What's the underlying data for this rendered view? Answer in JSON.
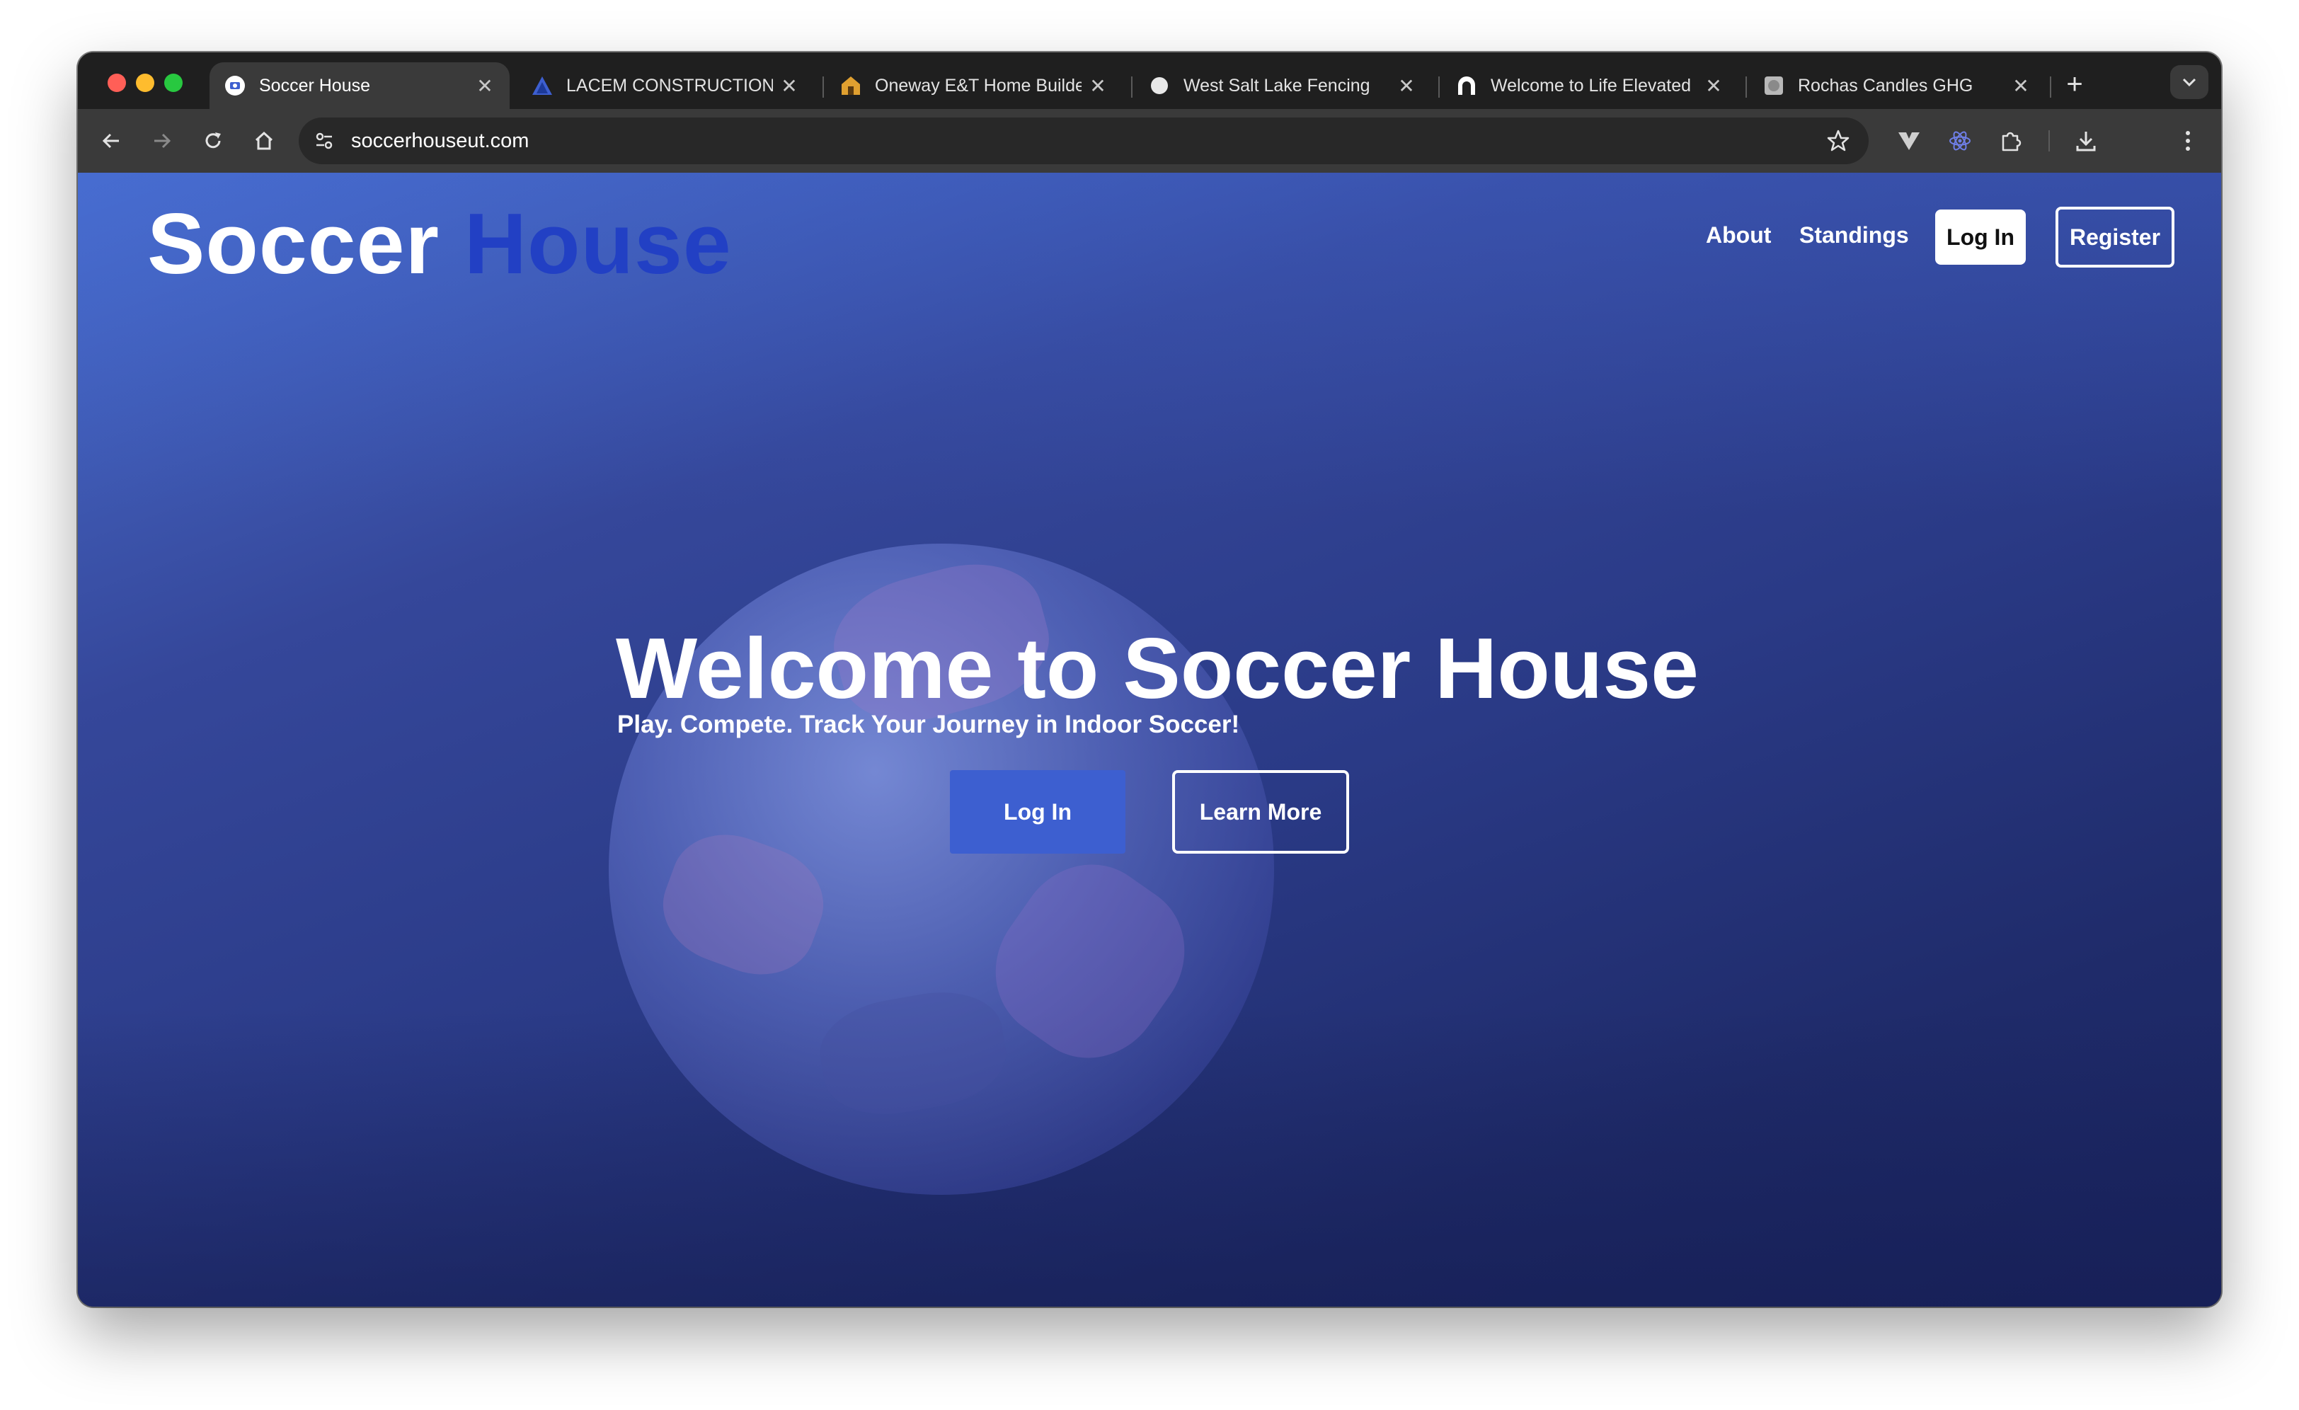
{
  "browser": {
    "tabs": [
      {
        "title": "Soccer House",
        "icon": "soccer-house-favicon",
        "active": true
      },
      {
        "title": "LACEM CONSTRUCTION",
        "icon": "triangle-favicon",
        "active": false
      },
      {
        "title": "Oneway E&T Home Builde",
        "icon": "house-favicon",
        "active": false
      },
      {
        "title": "West Salt Lake Fencing",
        "icon": "circle-favicon",
        "active": false
      },
      {
        "title": "Welcome to Life Elevated",
        "icon": "arch-favicon",
        "active": false
      },
      {
        "title": "Rochas Candles GHG",
        "icon": "candle-favicon",
        "active": false
      }
    ],
    "close_glyph": "✕",
    "new_tab_glyph": "+",
    "url": "soccerhouseut.com"
  },
  "site": {
    "logo_part1": "Soccer",
    "logo_part2": "House",
    "nav": {
      "about": "About",
      "standings": "Standings",
      "login": "Log In",
      "register": "Register"
    },
    "hero": {
      "title": "Welcome to Soccer House",
      "subtitle": "Play. Compete. Track Your Journey in Indoor Soccer!",
      "login_button": "Log In",
      "learn_more_button": "Learn More"
    }
  },
  "colors": {
    "brand_blue": "#2240c4",
    "button_blue": "#3d5fd0",
    "window_chrome": "#1f1f1f"
  }
}
